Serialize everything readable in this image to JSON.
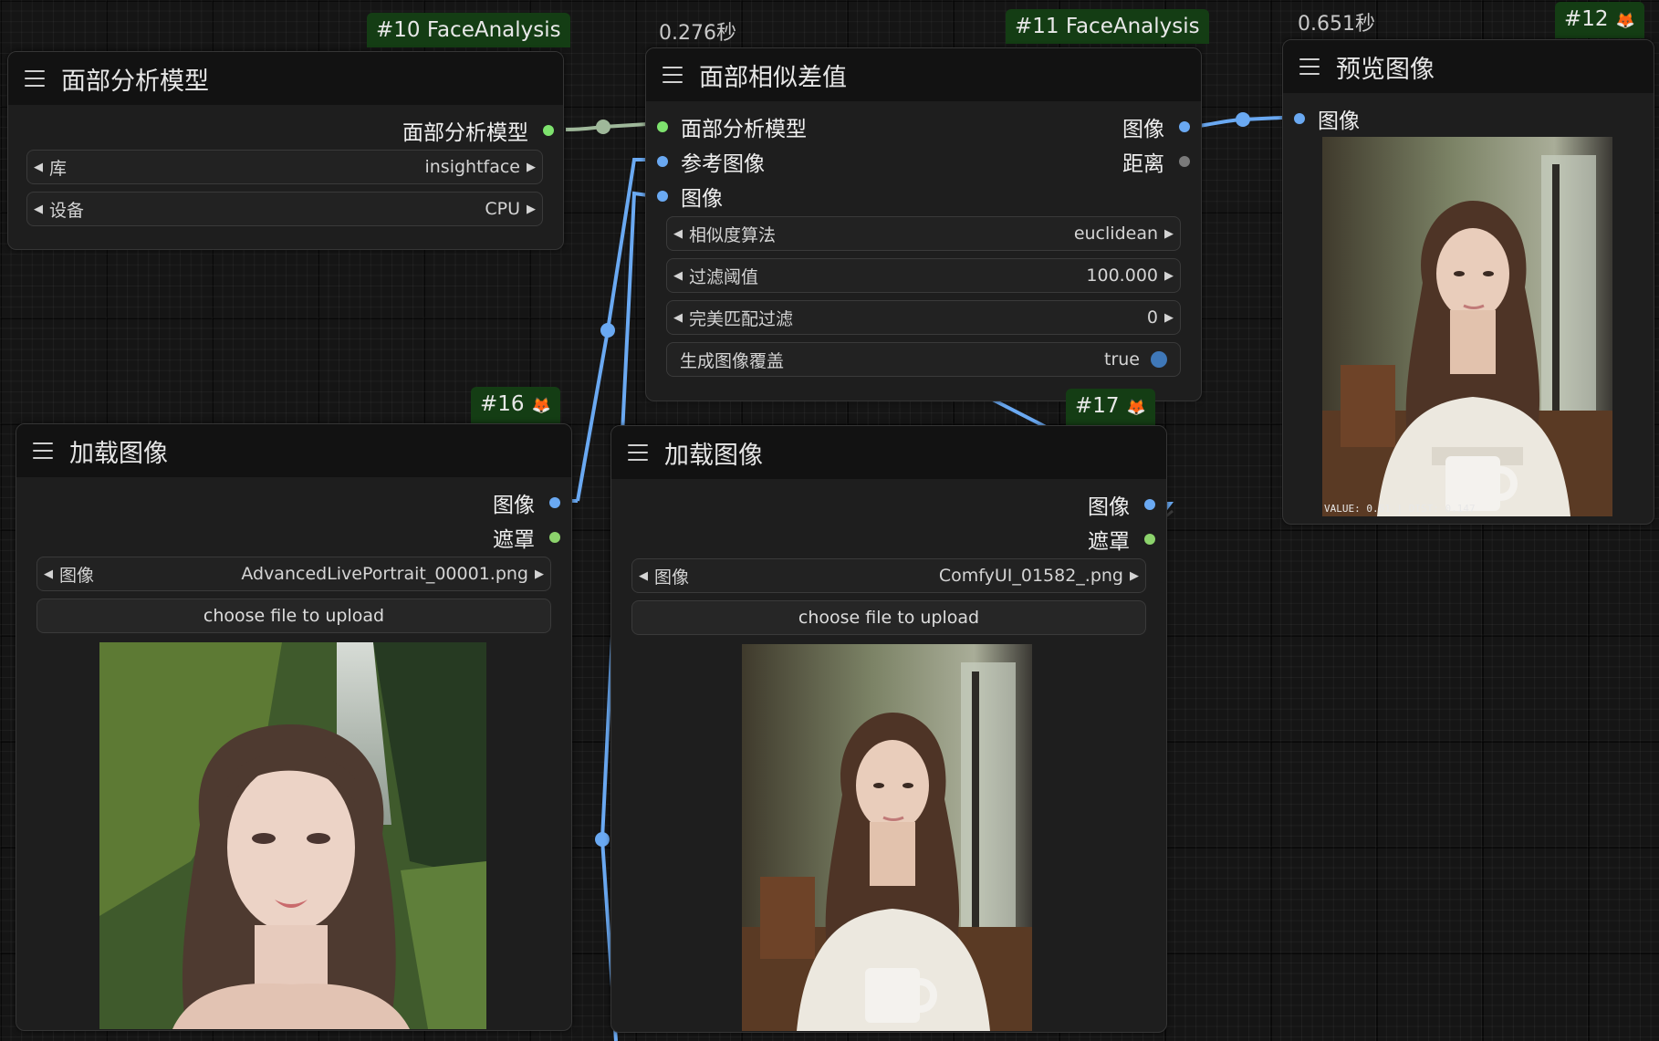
{
  "nodes": {
    "face_model": {
      "badge": "#10 FaceAnalysis",
      "title": "面部分析模型",
      "output": "面部分析模型",
      "widgets": [
        {
          "label": "库",
          "value": "insightface"
        },
        {
          "label": "设备",
          "value": "CPU"
        }
      ]
    },
    "face_diff": {
      "timing": "0.276秒",
      "badge": "#11 FaceAnalysis",
      "title": "面部相似差值",
      "inputs": [
        "面部分析模型",
        "参考图像",
        "图像"
      ],
      "outputs": [
        "图像",
        "距离"
      ],
      "widgets": [
        {
          "label": "相似度算法",
          "value": "euclidean"
        },
        {
          "label": "过滤阈值",
          "value": "100.000"
        },
        {
          "label": "完美匹配过滤",
          "value": "0"
        }
      ],
      "toggle": {
        "label": "生成图像覆盖",
        "value": "true"
      }
    },
    "preview": {
      "timing": "0.651秒",
      "badge": "#12",
      "title": "预览图像",
      "input": "图像",
      "caption": "VALUE: 0.61 | DIST: 0.147"
    },
    "load16": {
      "badge": "#16",
      "title": "加载图像",
      "outputs": [
        "图像",
        "遮罩"
      ],
      "widget": {
        "label": "图像",
        "value": "AdvancedLivePortrait_00001.png"
      },
      "upload": "choose file to upload"
    },
    "load17": {
      "badge": "#17",
      "title": "加载图像",
      "outputs": [
        "图像",
        "遮罩"
      ],
      "widget": {
        "label": "图像",
        "value": "ComfyUI_01582_.png"
      },
      "upload": "choose file to upload"
    }
  },
  "icons": {
    "menu": "hamburger-menu-icon",
    "fox": "fox-icon",
    "arrow_left": "triangle-left-icon",
    "arrow_right": "triangle-right-icon"
  },
  "colors": {
    "canvas": "#151515",
    "node_body": "#1e1e1e",
    "node_header": "#121212",
    "badge": "#143d14",
    "image_link": "#6aa9f2",
    "mask_link": "#8cd36c",
    "face_link": "#9fb89a"
  }
}
